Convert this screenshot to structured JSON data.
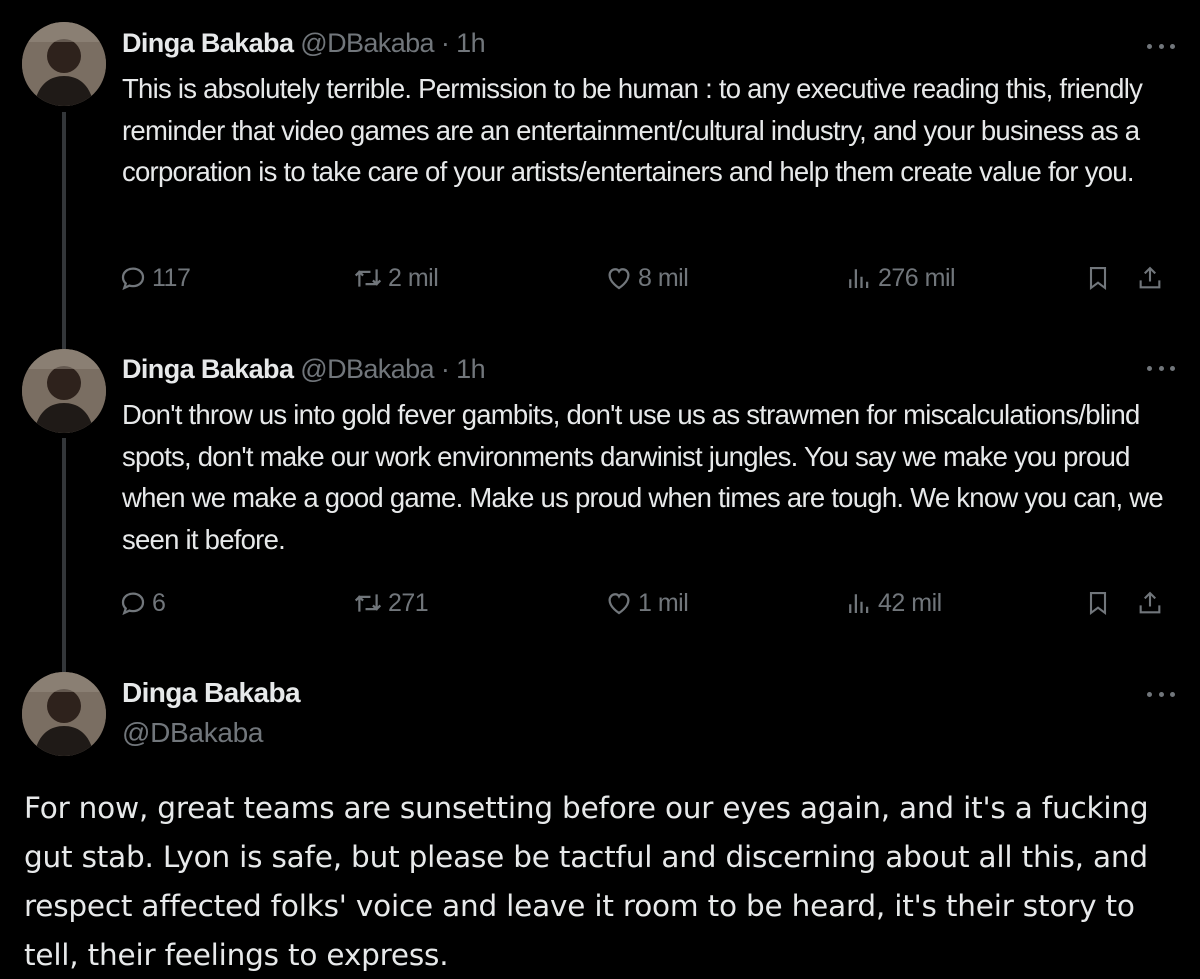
{
  "tweets": [
    {
      "author": "Dinga Bakaba",
      "handle": "@DBakaba",
      "separator": "·",
      "time": "1h",
      "text": "This is absolutely terrible. Permission to be human : to any executive reading this, friendly reminder that video games are an entertainment/cultural industry, and your business as a corporation is to take care of your artists/entertainers and help them create value for you.",
      "replies": "117",
      "retweets": "2 mil",
      "likes": "8 mil",
      "views": "276 mil"
    },
    {
      "author": "Dinga Bakaba",
      "handle": "@DBakaba",
      "separator": "·",
      "time": "1h",
      "text": "Don't throw us into gold fever gambits, don't use us as strawmen for miscalculations/blind spots, don't make our work environments darwinist jungles. You say we make you proud when we make a good game. Make us proud when times are tough. We know you can, we seen it before.",
      "replies": "6",
      "retweets": "271",
      "likes": "1 mil",
      "views": "42 mil"
    },
    {
      "author": "Dinga Bakaba",
      "handle": "@DBakaba",
      "text": "For now, great teams are sunsetting before our eyes again, and it's a fucking gut stab. Lyon is safe, but please be tactful and discerning about all this, and respect affected folks' voice and leave it room to be heard, it's their story to tell, their feelings to express."
    }
  ],
  "icons": {
    "reply": "reply-icon",
    "retweet": "retweet-icon",
    "like": "heart-icon",
    "views": "views-icon",
    "bookmark": "bookmark-icon",
    "share": "share-icon",
    "more": "more-icon"
  },
  "colors": {
    "background": "#000000",
    "text": "#e7e9ea",
    "secondary": "#71767b",
    "thread_line": "#333639"
  }
}
